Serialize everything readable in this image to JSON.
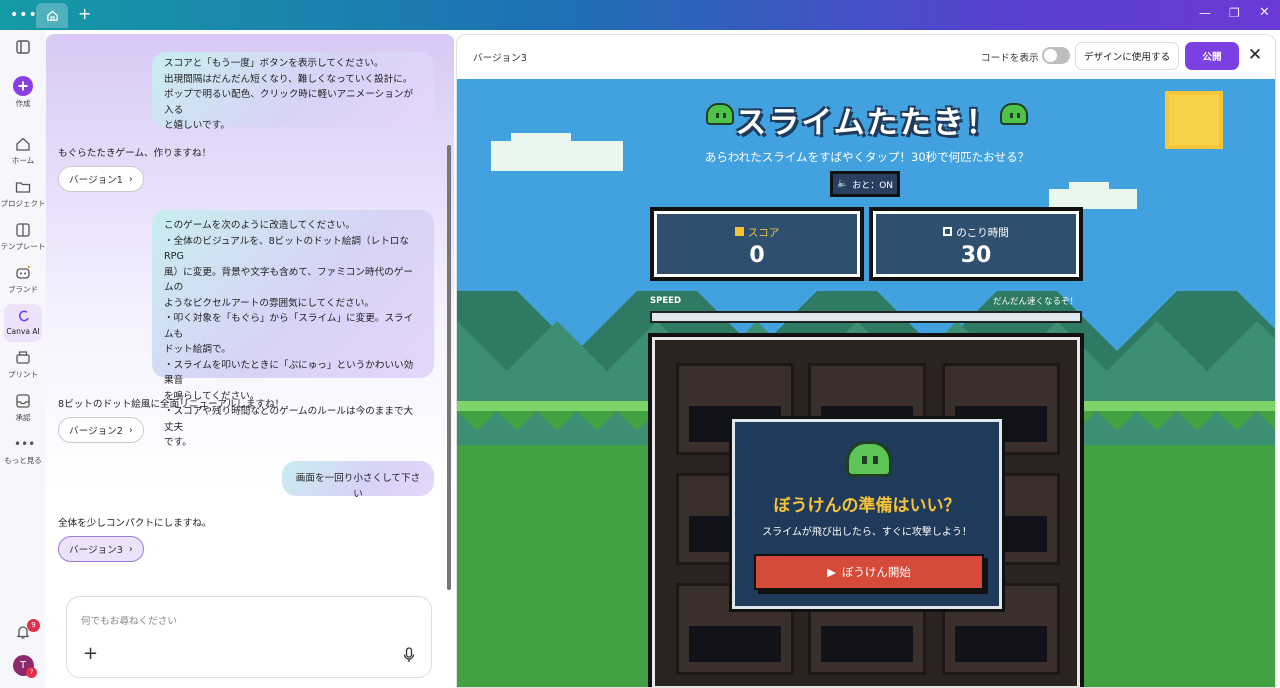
{
  "window": {
    "home_tab_icon": "home-icon",
    "new_tab": "+"
  },
  "sidebar": {
    "create_label": "作成",
    "items": [
      {
        "label": "ホーム",
        "icon": "home-icon"
      },
      {
        "label": "プロジェクト",
        "icon": "folder-icon"
      },
      {
        "label": "テンプレート",
        "icon": "template-icon"
      },
      {
        "label": "ブランド",
        "icon": "brand-icon"
      },
      {
        "label": "Canva AI",
        "icon": "canva-ai-icon"
      },
      {
        "label": "プリント",
        "icon": "print-icon"
      },
      {
        "label": "承認",
        "icon": "inbox-icon"
      },
      {
        "label": "もっと見る",
        "icon": "more-icon"
      }
    ],
    "notifications_badge": "9",
    "avatar_initial": "T",
    "avatar_badge": "7"
  },
  "chat": {
    "msg1": [
      "スコアと「もう一度」ボタンを表示してください。",
      "出現間隔はだんだん短くなり、難しくなっていく設計に。",
      "ポップで明るい配色、クリック時に軽いアニメーションが入る",
      "と嬉しいです。"
    ],
    "reply1": "もぐらたたきゲーム、作りますね！",
    "version1": "バージョン1",
    "msg2": [
      "このゲームを次のように改造してください。",
      "・全体のビジュアルを、8ビットのドット絵調（レトロなRPG",
      "風）に変更。背景や文字も含めて、ファミコン時代のゲームの",
      "ようなピクセルアートの雰囲気にしてください。",
      "・叩く対象を「もぐら」から「スライム」に変更。スライムも",
      "ドット絵調で。",
      "・スライムを叩いたときに「ぷにゅっ」というかわいい効果音",
      "を鳴らしてください。",
      "・スコアや残り時間などのゲームのルールは今のままで大丈夫",
      "です。"
    ],
    "reply2": "8ビットのドット絵風に全面リニューアルしますね！",
    "version2": "バージョン2",
    "msg3": "画面を一回り小さくして下さい",
    "reply3": "全体を少しコンパクトにしますね。",
    "version3": "バージョン3",
    "input_placeholder": "何でもお尋ねください"
  },
  "preview": {
    "title": "バージョン3",
    "show_code_label": "コードを表示",
    "use_in_design": "デザインに使用する",
    "publish": "公開"
  },
  "game": {
    "title": "スライムたたき！",
    "subtitle": "あらわれたスライムをすばやくタップ！30秒で何匹たおせる？",
    "sound": "おと：ON",
    "score_label": "スコア",
    "score_value": "0",
    "time_label": "のこり時間",
    "time_value": "30",
    "speed_label": "SPEED",
    "speed_note": "だんだん速くなるぞ！",
    "speed_fill": 0,
    "dialog_title": "ぼうけんの準備はいい？",
    "dialog_sub": "スライムが飛び出したら、すぐに攻撃しよう！",
    "start_button": "ぼうけん開始"
  },
  "colors": {
    "accent": "#7b3fe4",
    "sky": "#42a2e0",
    "grass": "#42a142",
    "start_button": "#d64a3a",
    "title_gold": "#f5c238"
  }
}
